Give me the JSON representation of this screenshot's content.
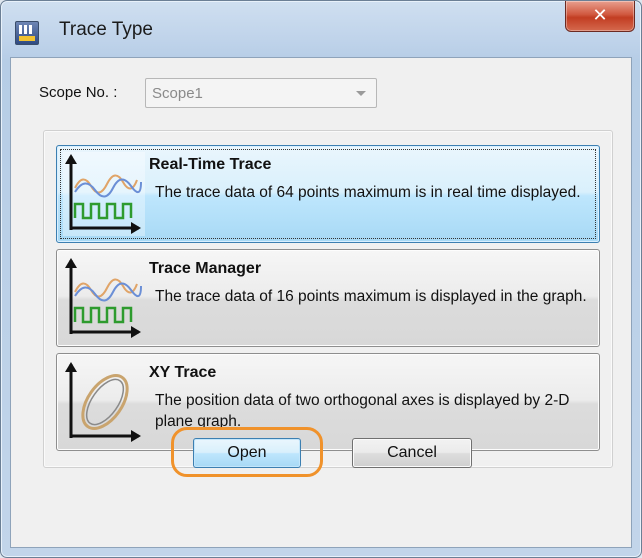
{
  "window": {
    "title": "Trace Type",
    "close_glyph": "✕"
  },
  "scope": {
    "label": "Scope No. :",
    "value": "Scope1"
  },
  "options": [
    {
      "title": "Real-Time Trace",
      "description": "The trace data of 64 points maximum is in real time displayed.",
      "icon": "realtime-trace-icon",
      "selected": true
    },
    {
      "title": "Trace Manager",
      "description": "The trace data of 16 points maximum is displayed in the graph.",
      "icon": "trace-manager-icon",
      "selected": false
    },
    {
      "title": "XY Trace",
      "description": "The position data of two orthogonal axes is displayed by 2-D plane graph.",
      "icon": "xy-trace-icon",
      "selected": false
    }
  ],
  "buttons": {
    "open": "Open",
    "cancel": "Cancel"
  },
  "colors": {
    "highlight": "#f0922b",
    "selected": "#3c7fb1",
    "close": "#c23d22"
  }
}
